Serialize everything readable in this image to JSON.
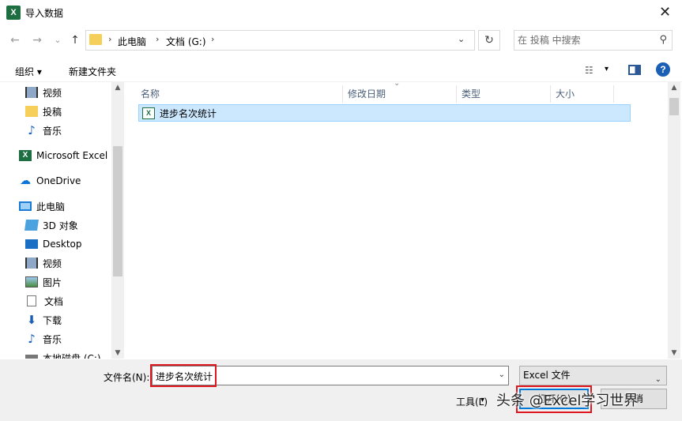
{
  "window": {
    "title": "导入数据",
    "close_glyph": "✕"
  },
  "nav_buttons": {
    "back": "←",
    "forward": "→",
    "recent": "⌄",
    "up": "↑"
  },
  "address": {
    "crumbs": [
      "此电脑",
      "文档 (G:)"
    ],
    "separator": "›",
    "dropdown": "⌄",
    "refresh": "↻"
  },
  "search": {
    "placeholder": "在 投稿 中搜索"
  },
  "toolbar": {
    "organize": "组织 ▾",
    "new_folder": "新建文件夹",
    "view_drop": "▾",
    "help": "?"
  },
  "nav_pane": {
    "items": [
      {
        "label": "视频",
        "icon": "film-icon"
      },
      {
        "label": "投稿",
        "icon": "folder-icon"
      },
      {
        "label": "音乐",
        "icon": "music-icon"
      },
      {
        "label": "Microsoft Excel",
        "icon": "excel-icon"
      },
      {
        "label": "OneDrive",
        "icon": "cloud-icon"
      },
      {
        "label": "此电脑",
        "icon": "computer-icon"
      },
      {
        "label": "3D 对象",
        "icon": "cube-icon"
      },
      {
        "label": "Desktop",
        "icon": "desktop-icon"
      },
      {
        "label": "视频",
        "icon": "film-icon"
      },
      {
        "label": "图片",
        "icon": "picture-icon"
      },
      {
        "label": "文档",
        "icon": "document-icon"
      },
      {
        "label": "下载",
        "icon": "download-icon"
      },
      {
        "label": "音乐",
        "icon": "music-icon"
      },
      {
        "label": "本地磁盘 (C:)",
        "icon": "drive-icon"
      }
    ]
  },
  "columns": [
    "名称",
    "修改日期",
    "类型",
    "大小"
  ],
  "files": [
    {
      "name": "进步名次统计",
      "icon": "excel-file-icon"
    }
  ],
  "bottom": {
    "filename_label": "文件名(N):",
    "filename_value": "进步名次统计",
    "filetype": "Excel 文件",
    "tools": "工具(L)",
    "open": "打开(O)",
    "cancel": "取消"
  },
  "watermark": "头条 @Excel学习世界",
  "colors": {
    "selection": "#cce8ff",
    "highlight_box": "#e0171c",
    "accent": "#0078d7"
  }
}
